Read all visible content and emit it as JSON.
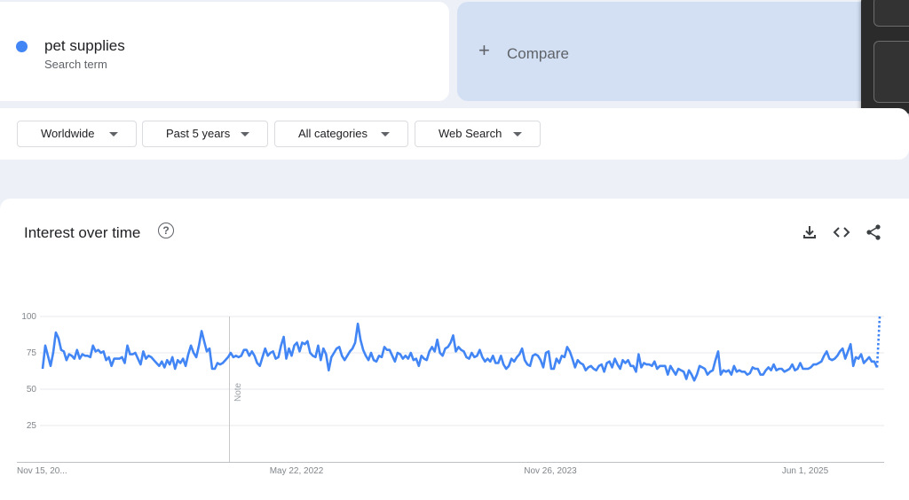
{
  "search_term": {
    "name": "pet supplies",
    "subtitle": "Search term",
    "color": "#4285f4"
  },
  "compare": {
    "label": "Compare",
    "icon": "plus-icon"
  },
  "filters": {
    "region": "Worldwide",
    "time_range": "Past 5 years",
    "category": "All categories",
    "search_type": "Web Search"
  },
  "chart_card": {
    "title": "Interest over time",
    "help_icon": "help-circle-icon",
    "note_label": "Note",
    "tools": [
      "download-icon",
      "embed-code-icon",
      "share-icon"
    ]
  },
  "chart_data": {
    "type": "line",
    "title": "Interest over time",
    "ylim": [
      0,
      100
    ],
    "yticks": [
      25,
      50,
      75,
      100
    ],
    "xtick_labels": [
      "Nov 15, 20...",
      "May 22, 2022",
      "Nov 26, 2023",
      "Jun 1, 2025"
    ],
    "x_start": "Nov 15, 2020",
    "x_end": "Nov 2025",
    "grid": true,
    "series": [
      {
        "name": "pet supplies",
        "color": "#4285f4",
        "values": [
          64,
          80,
          73,
          66,
          75,
          89,
          85,
          77,
          76,
          70,
          74,
          73,
          71,
          77,
          71,
          74,
          73,
          73,
          72,
          80,
          76,
          77,
          75,
          76,
          70,
          72,
          66,
          71,
          71,
          71,
          72,
          68,
          80,
          74,
          74,
          75,
          71,
          67,
          76,
          71,
          73,
          72,
          70,
          68,
          66,
          69,
          65,
          70,
          67,
          72,
          64,
          70,
          68,
          71,
          66,
          74,
          80,
          75,
          72,
          80,
          90,
          83,
          76,
          78,
          64,
          64,
          68,
          67,
          68,
          70,
          72,
          75,
          72,
          73,
          72,
          73,
          77,
          77,
          73,
          76,
          73,
          68,
          66,
          72,
          78,
          73,
          75,
          76,
          71,
          72,
          80,
          86,
          71,
          78,
          73,
          80,
          82,
          76,
          82,
          81,
          83,
          75,
          73,
          72,
          80,
          70,
          78,
          74,
          63,
          72,
          75,
          78,
          79,
          73,
          70,
          73,
          76,
          78,
          82,
          95,
          84,
          77,
          73,
          70,
          75,
          70,
          69,
          73,
          72,
          79,
          77,
          77,
          73,
          69,
          75,
          74,
          71,
          73,
          71,
          75,
          70,
          71,
          66,
          73,
          71,
          70,
          76,
          79,
          76,
          84,
          75,
          73,
          78,
          79,
          82,
          87,
          76,
          79,
          77,
          76,
          72,
          71,
          75,
          72,
          73,
          77,
          72,
          69,
          71,
          69,
          73,
          68,
          68,
          73,
          67,
          64,
          66,
          71,
          69,
          72,
          74,
          78,
          70,
          67,
          66,
          73,
          74,
          73,
          70,
          65,
          75,
          76,
          64,
          64,
          71,
          68,
          73,
          72,
          79,
          76,
          71,
          65,
          70,
          68,
          67,
          63,
          65,
          66,
          64,
          63,
          66,
          67,
          62,
          68,
          69,
          65,
          71,
          67,
          64,
          70,
          68,
          70,
          66,
          66,
          62,
          74,
          65,
          68,
          67,
          67,
          66,
          69,
          64,
          66,
          66,
          66,
          60,
          66,
          63,
          60,
          64,
          63,
          62,
          57,
          63,
          60,
          56,
          60,
          66,
          65,
          64,
          60,
          62,
          63,
          70,
          76,
          60,
          63,
          62,
          63,
          60,
          66,
          62,
          63,
          62,
          62,
          60,
          61,
          65,
          64,
          64,
          60,
          60,
          63,
          65,
          63,
          67,
          63,
          64,
          64,
          62,
          63,
          64,
          67,
          63,
          64,
          68,
          64,
          64,
          64,
          65,
          67,
          67,
          68,
          69,
          73,
          76,
          71,
          70,
          71,
          73,
          76,
          78,
          71,
          76,
          81,
          66,
          72,
          71,
          74,
          68,
          70,
          72,
          69,
          69,
          65
        ],
        "partial_values": [
          65,
          100
        ]
      }
    ]
  }
}
